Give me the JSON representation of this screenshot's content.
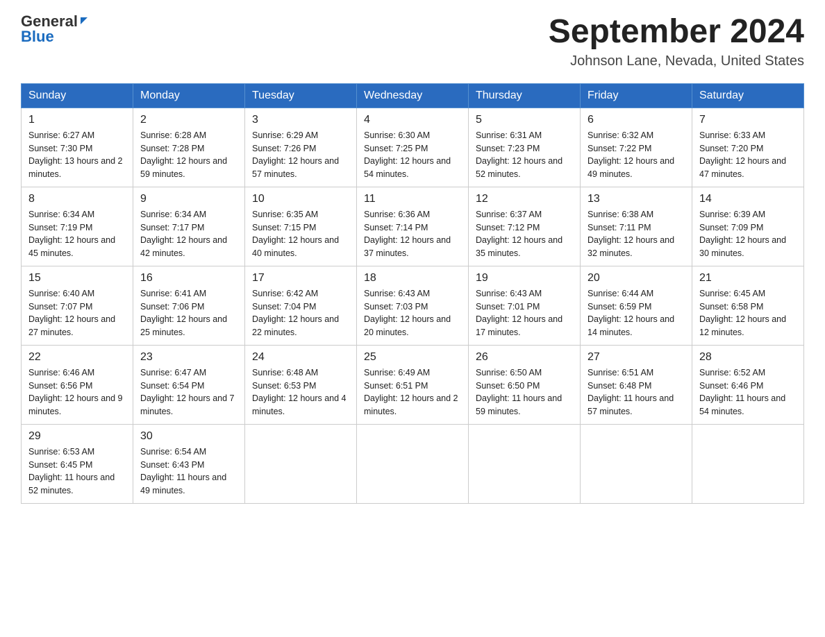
{
  "header": {
    "logo_general": "General",
    "logo_blue": "Blue",
    "title": "September 2024",
    "subtitle": "Johnson Lane, Nevada, United States"
  },
  "weekdays": [
    "Sunday",
    "Monday",
    "Tuesday",
    "Wednesday",
    "Thursday",
    "Friday",
    "Saturday"
  ],
  "weeks": [
    [
      {
        "day": "1",
        "sunrise": "6:27 AM",
        "sunset": "7:30 PM",
        "daylight": "13 hours and 2 minutes."
      },
      {
        "day": "2",
        "sunrise": "6:28 AM",
        "sunset": "7:28 PM",
        "daylight": "12 hours and 59 minutes."
      },
      {
        "day": "3",
        "sunrise": "6:29 AM",
        "sunset": "7:26 PM",
        "daylight": "12 hours and 57 minutes."
      },
      {
        "day": "4",
        "sunrise": "6:30 AM",
        "sunset": "7:25 PM",
        "daylight": "12 hours and 54 minutes."
      },
      {
        "day": "5",
        "sunrise": "6:31 AM",
        "sunset": "7:23 PM",
        "daylight": "12 hours and 52 minutes."
      },
      {
        "day": "6",
        "sunrise": "6:32 AM",
        "sunset": "7:22 PM",
        "daylight": "12 hours and 49 minutes."
      },
      {
        "day": "7",
        "sunrise": "6:33 AM",
        "sunset": "7:20 PM",
        "daylight": "12 hours and 47 minutes."
      }
    ],
    [
      {
        "day": "8",
        "sunrise": "6:34 AM",
        "sunset": "7:19 PM",
        "daylight": "12 hours and 45 minutes."
      },
      {
        "day": "9",
        "sunrise": "6:34 AM",
        "sunset": "7:17 PM",
        "daylight": "12 hours and 42 minutes."
      },
      {
        "day": "10",
        "sunrise": "6:35 AM",
        "sunset": "7:15 PM",
        "daylight": "12 hours and 40 minutes."
      },
      {
        "day": "11",
        "sunrise": "6:36 AM",
        "sunset": "7:14 PM",
        "daylight": "12 hours and 37 minutes."
      },
      {
        "day": "12",
        "sunrise": "6:37 AM",
        "sunset": "7:12 PM",
        "daylight": "12 hours and 35 minutes."
      },
      {
        "day": "13",
        "sunrise": "6:38 AM",
        "sunset": "7:11 PM",
        "daylight": "12 hours and 32 minutes."
      },
      {
        "day": "14",
        "sunrise": "6:39 AM",
        "sunset": "7:09 PM",
        "daylight": "12 hours and 30 minutes."
      }
    ],
    [
      {
        "day": "15",
        "sunrise": "6:40 AM",
        "sunset": "7:07 PM",
        "daylight": "12 hours and 27 minutes."
      },
      {
        "day": "16",
        "sunrise": "6:41 AM",
        "sunset": "7:06 PM",
        "daylight": "12 hours and 25 minutes."
      },
      {
        "day": "17",
        "sunrise": "6:42 AM",
        "sunset": "7:04 PM",
        "daylight": "12 hours and 22 minutes."
      },
      {
        "day": "18",
        "sunrise": "6:43 AM",
        "sunset": "7:03 PM",
        "daylight": "12 hours and 20 minutes."
      },
      {
        "day": "19",
        "sunrise": "6:43 AM",
        "sunset": "7:01 PM",
        "daylight": "12 hours and 17 minutes."
      },
      {
        "day": "20",
        "sunrise": "6:44 AM",
        "sunset": "6:59 PM",
        "daylight": "12 hours and 14 minutes."
      },
      {
        "day": "21",
        "sunrise": "6:45 AM",
        "sunset": "6:58 PM",
        "daylight": "12 hours and 12 minutes."
      }
    ],
    [
      {
        "day": "22",
        "sunrise": "6:46 AM",
        "sunset": "6:56 PM",
        "daylight": "12 hours and 9 minutes."
      },
      {
        "day": "23",
        "sunrise": "6:47 AM",
        "sunset": "6:54 PM",
        "daylight": "12 hours and 7 minutes."
      },
      {
        "day": "24",
        "sunrise": "6:48 AM",
        "sunset": "6:53 PM",
        "daylight": "12 hours and 4 minutes."
      },
      {
        "day": "25",
        "sunrise": "6:49 AM",
        "sunset": "6:51 PM",
        "daylight": "12 hours and 2 minutes."
      },
      {
        "day": "26",
        "sunrise": "6:50 AM",
        "sunset": "6:50 PM",
        "daylight": "11 hours and 59 minutes."
      },
      {
        "day": "27",
        "sunrise": "6:51 AM",
        "sunset": "6:48 PM",
        "daylight": "11 hours and 57 minutes."
      },
      {
        "day": "28",
        "sunrise": "6:52 AM",
        "sunset": "6:46 PM",
        "daylight": "11 hours and 54 minutes."
      }
    ],
    [
      {
        "day": "29",
        "sunrise": "6:53 AM",
        "sunset": "6:45 PM",
        "daylight": "11 hours and 52 minutes."
      },
      {
        "day": "30",
        "sunrise": "6:54 AM",
        "sunset": "6:43 PM",
        "daylight": "11 hours and 49 minutes."
      },
      null,
      null,
      null,
      null,
      null
    ]
  ]
}
